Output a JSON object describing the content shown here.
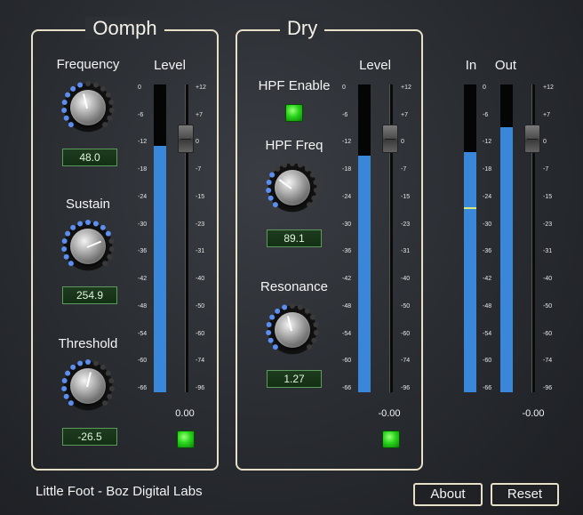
{
  "oomph": {
    "title": "Oomph",
    "frequency": {
      "label": "Frequency",
      "value": "48.0",
      "level": 0.45
    },
    "sustain": {
      "label": "Sustain",
      "value": "254.9",
      "level": 0.75
    },
    "threshold": {
      "label": "Threshold",
      "value": "-26.5",
      "level": 0.55
    },
    "level_label": "Level",
    "meter_fill": 0.8,
    "fader_readout": "0.00"
  },
  "dry": {
    "title": "Dry",
    "hpf_enable_label": "HPF Enable",
    "hpf_freq": {
      "label": "HPF Freq",
      "value": "89.1",
      "level": 0.3
    },
    "resonance": {
      "label": "Resonance",
      "value": "1.27",
      "level": 0.45
    },
    "level_label": "Level",
    "meter_fill": 0.77,
    "fader_readout": "-0.00"
  },
  "output": {
    "in_label": "In",
    "out_label": "Out",
    "in_fill": 0.78,
    "out_fill": 0.86,
    "fader_readout": "-0.00"
  },
  "meter_scale": [
    "0",
    "-6",
    "-12",
    "-18",
    "-24",
    "-30",
    "-36",
    "-42",
    "-48",
    "-54",
    "-60",
    "-66"
  ],
  "fader_scale": [
    "+12",
    "+7",
    "0",
    "-7",
    "-15",
    "-23",
    "-31",
    "-40",
    "-50",
    "-60",
    "-74",
    "-96"
  ],
  "footer": {
    "brand": "Little Foot - Boz Digital Labs",
    "about_label": "About",
    "reset_label": "Reset"
  },
  "colors": {
    "accent_blue": "#3a86d8",
    "led_green": "#27d61a",
    "frame": "#e7dfc6"
  }
}
